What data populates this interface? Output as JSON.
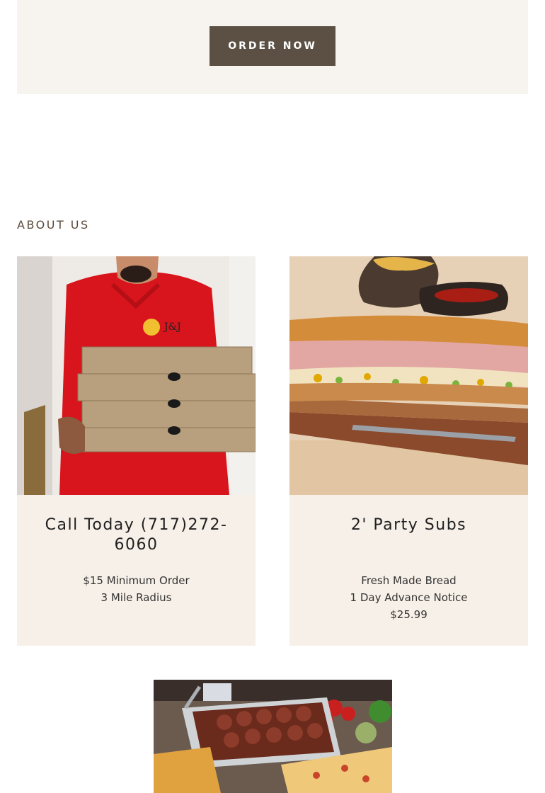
{
  "hero": {
    "order_button": "ORDER NOW"
  },
  "about": {
    "heading": "ABOUT US",
    "cards": [
      {
        "title": "Call Today (717)272-6060",
        "lines": [
          "$15 Minimum Order",
          "3 Mile Radius"
        ]
      },
      {
        "title": "2' Party Subs",
        "lines": [
          "Fresh Made Bread",
          "1 Day Advance Notice",
          "$25.99"
        ]
      }
    ]
  },
  "images": {
    "delivery": "delivery-person-pizza-boxes",
    "subs": "party-sub-sandwich",
    "catering": "catering-trays"
  }
}
